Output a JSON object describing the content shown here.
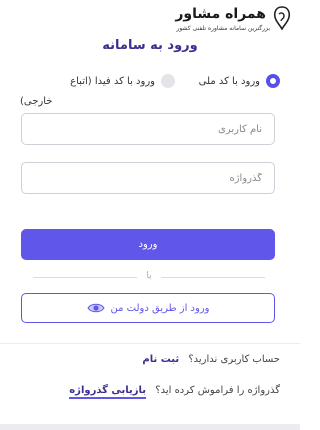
{
  "brand": {
    "name": "همراه مشاور",
    "tagline": "بزرگترین سامانه مشاوره تلفنی کشور"
  },
  "login": {
    "title": "ورود به سامانه",
    "options": [
      {
        "label": "ورود با کد ملی",
        "selected": true
      },
      {
        "label": "ورود با کد فیدا (اتباع",
        "selected": false
      }
    ],
    "option_wrap_text": "خارجی)",
    "username_placeholder": "نام کاربری",
    "password_placeholder": "گذرواژه",
    "submit_label": "ورود",
    "divider_text": "یا",
    "gov_login_label": "ورود از طریق دولت من"
  },
  "footer": {
    "no_account_text": "حساب کاربری ندارید؟",
    "register_link": "ثبت نام",
    "forgot_text": "گذرواژه را فراموش کرده اید؟",
    "recover_link": "بازیابی گذرواژه"
  },
  "colors": {
    "accent": "#6156ea",
    "title": "#3d2f8f"
  }
}
